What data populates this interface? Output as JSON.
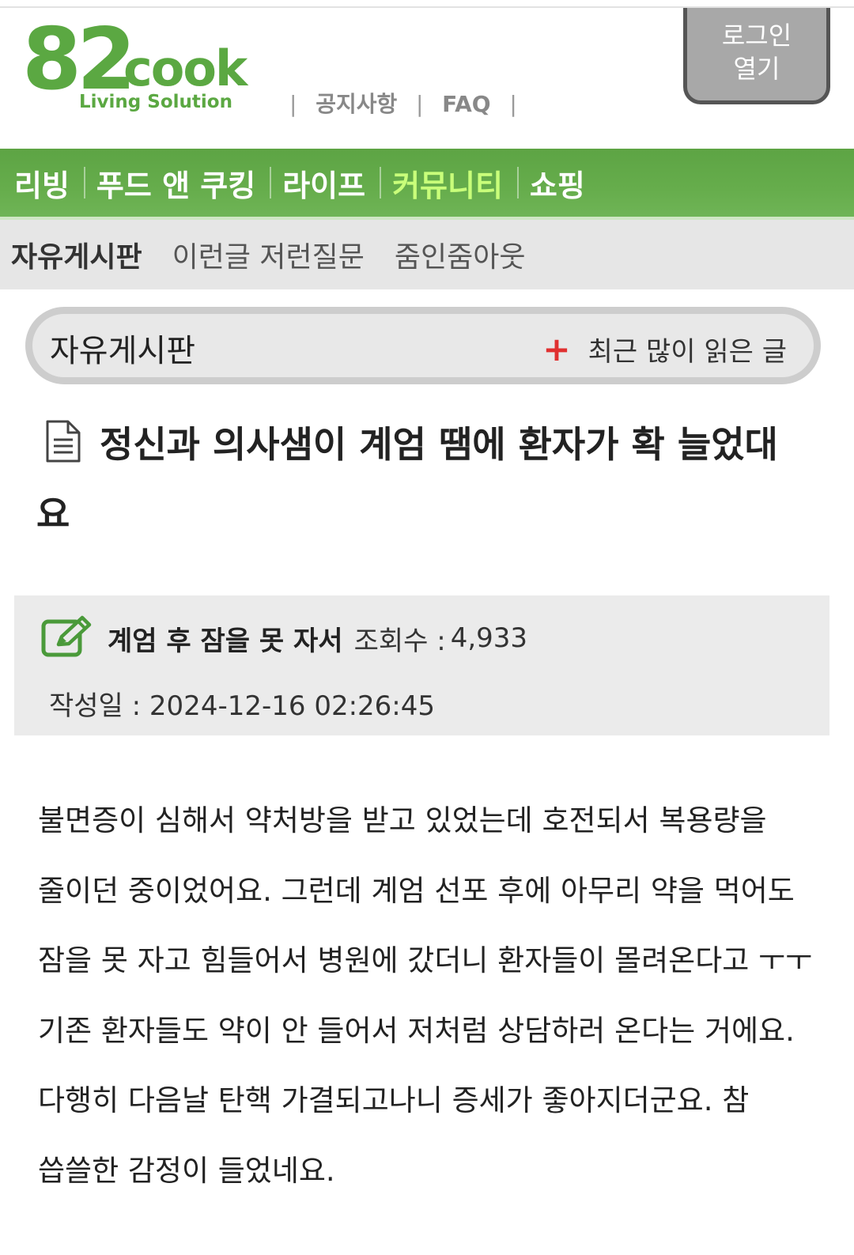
{
  "header": {
    "logo_number": "82",
    "logo_word": "cook",
    "logo_tagline": "Living Solution",
    "links": [
      "공지사항",
      "FAQ"
    ],
    "login_line1": "로그인",
    "login_line2": "열기"
  },
  "main_nav": {
    "items": [
      {
        "label": "리빙"
      },
      {
        "label": "푸드 앤 쿠킹"
      },
      {
        "label": "라이프"
      },
      {
        "label": "커뮤니티"
      },
      {
        "label": "쇼핑"
      }
    ],
    "active_index": 3
  },
  "sub_nav": {
    "items": [
      {
        "label": "자유게시판"
      },
      {
        "label": "이런글 저런질문"
      },
      {
        "label": "줌인줌아웃"
      }
    ],
    "active_index": 0
  },
  "board": {
    "name": "자유게시판",
    "popular_plus": "+",
    "popular_label": "최근 많이 읽은 글"
  },
  "post": {
    "title": "정신과 의사샘이 계엄 땜에 환자가 확 늘었대요",
    "author": "계엄 후 잠을 못 자서",
    "views_label": "조회수 :",
    "views": "4,933",
    "date_label": "작성일 :",
    "date": "2024-12-16 02:26:45",
    "body": "불면증이 심해서 약처방을 받고 있었는데 호전되서 복용량을 줄이던 중이었어요. 그런데 계엄 선포 후에 아무리 약을 먹어도 잠을 못 자고 힘들어서 병원에 갔더니 환자들이 몰려온다고 ㅜㅜ 기존 환자들도 약이 안 들어서 저처럼 상담하러 온다는 거에요. 다행히 다음날 탄핵 가결되고나니 증세가 좋아지더군요. 참 씁쓸한 감정이 들었네요."
  },
  "colors": {
    "brand_green": "#5ba842",
    "nav_active": "#c9ff7a",
    "plus_red": "#e03030"
  },
  "icons": [
    "document-icon",
    "edit-icon",
    "plus-icon"
  ]
}
